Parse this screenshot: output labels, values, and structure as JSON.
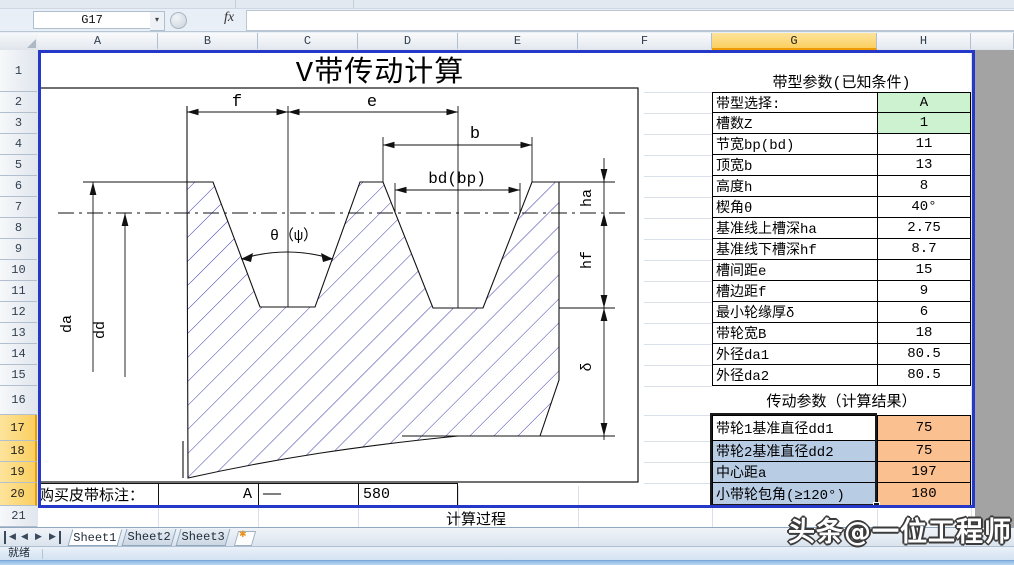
{
  "chrome": {
    "name_box": "G17",
    "fx_label": "fx",
    "formula_value": "",
    "status_text": "就绪",
    "watermark": "头条@一位工程师",
    "nav_tabs": [
      "first-sheet",
      "prev-sheet",
      "next-sheet",
      "last-sheet"
    ]
  },
  "colors": {
    "selected_header": "#fbcf60",
    "green_cell": "#ccf2cf",
    "peach_cell": "#fac090",
    "blue_cell": "#b8cce4",
    "print_border": "#2638c8",
    "hatch": "#3d3dae"
  },
  "columns": {
    "labels": [
      "A",
      "B",
      "C",
      "D",
      "E",
      "F",
      "G",
      "H"
    ],
    "selected": "G"
  },
  "rows": {
    "labels": [
      "1",
      "2",
      "3",
      "4",
      "5",
      "6",
      "7",
      "8",
      "9",
      "10",
      "11",
      "12",
      "13",
      "14",
      "15",
      "16",
      "17",
      "18",
      "19",
      "20",
      "21"
    ],
    "selected": [
      "17",
      "18",
      "19",
      "20"
    ]
  },
  "tabs": [
    {
      "label": "Sheet1",
      "active": true
    },
    {
      "label": "Sheet2",
      "active": false
    },
    {
      "label": "Sheet3",
      "active": false
    }
  ],
  "sheet": {
    "title": "V带传动计算",
    "calc_note": "计算过程",
    "purchase": {
      "label": "购买皮带标注：",
      "belt_type": "A",
      "dash": "——",
      "length": "580"
    },
    "param_table": {
      "header": "带型参数(已知条件)",
      "rows": [
        {
          "label": "带型选择:",
          "value": "A",
          "bg": "green",
          "comment": true
        },
        {
          "label": "槽数Z",
          "value": "1",
          "bg": "green",
          "comment": true
        },
        {
          "label": "节宽bp(bd)",
          "value": "11",
          "bg": "white",
          "comment": false
        },
        {
          "label": "顶宽b",
          "value": "13",
          "bg": "white",
          "comment": false
        },
        {
          "label": "高度h",
          "value": "8",
          "bg": "white",
          "comment": false
        },
        {
          "label": "楔角θ",
          "value": "40°",
          "bg": "white",
          "comment": false
        },
        {
          "label": "基准线上槽深ha",
          "value": "2.75",
          "bg": "white",
          "comment": false
        },
        {
          "label": "基准线下槽深hf",
          "value": "8.7",
          "bg": "white",
          "comment": false
        },
        {
          "label": "槽间距e",
          "value": "15",
          "bg": "white",
          "comment": false
        },
        {
          "label": "槽边距f",
          "value": "9",
          "bg": "white",
          "comment": false
        },
        {
          "label": "最小轮缘厚δ",
          "value": "6",
          "bg": "white",
          "comment": false
        },
        {
          "label": "带轮宽B",
          "value": "18",
          "bg": "white",
          "comment": false
        },
        {
          "label": "外径da1",
          "value": "80.5",
          "bg": "white",
          "comment": false
        },
        {
          "label": "外径da2",
          "value": "80.5",
          "bg": "white",
          "comment": false
        }
      ]
    },
    "result_table": {
      "header": "传动参数（计算结果）",
      "rows": [
        {
          "label": "带轮1基准直径dd1",
          "value": "75"
        },
        {
          "label": "带轮2基准直径dd2",
          "value": "75"
        },
        {
          "label": "中心距a",
          "value": "197"
        },
        {
          "label": "小带轮包角(≥120°)",
          "value": "180"
        }
      ]
    },
    "drawing_labels": {
      "f": "f",
      "e": "e",
      "b": "b",
      "bd": "bd(bp)",
      "theta": "θ（ψ）",
      "ha": "ha",
      "hf": "hf",
      "delta": "δ",
      "da": "da",
      "dd": "dd"
    }
  }
}
